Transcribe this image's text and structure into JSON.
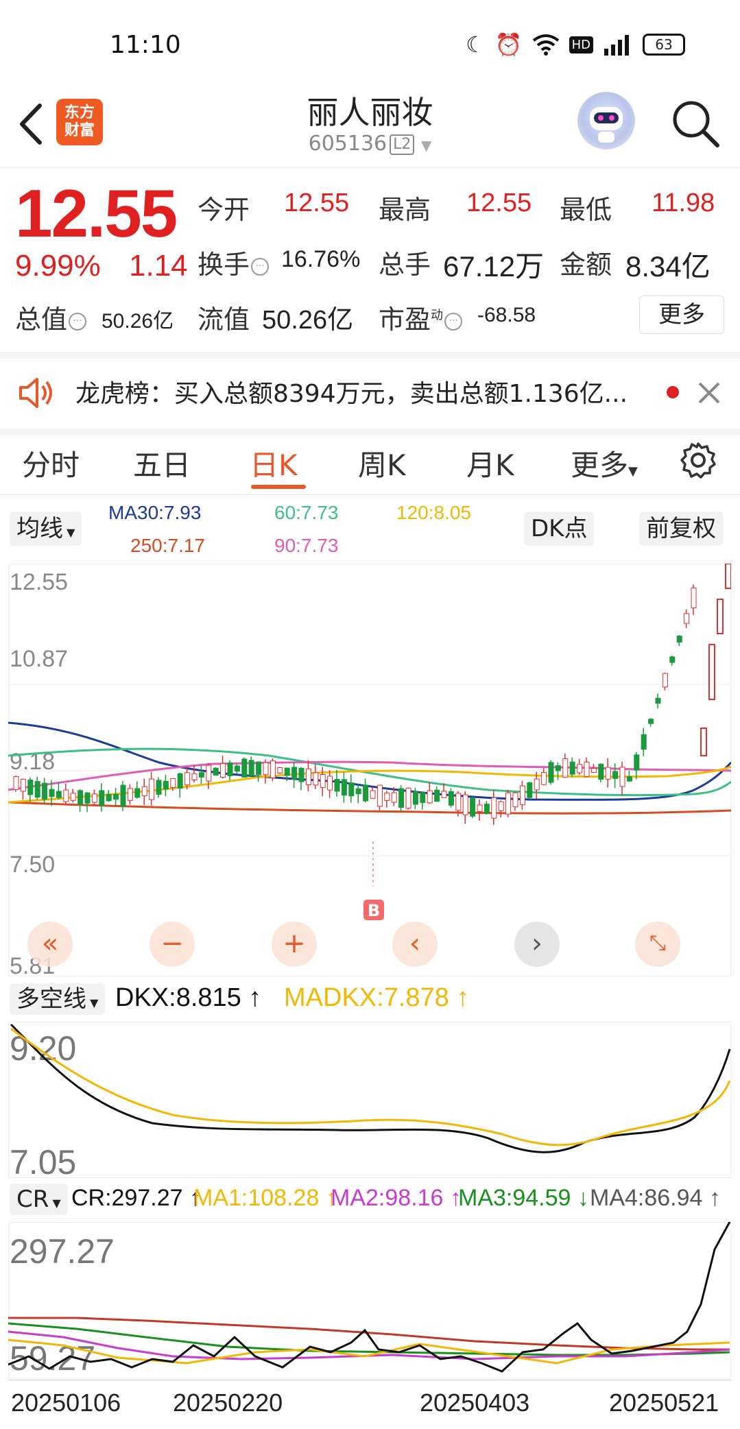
{
  "status": {
    "time": "11:10",
    "battery": "63"
  },
  "header": {
    "title": "丽人丽妆",
    "code": "605136",
    "level": "L2",
    "logo_line1": "东方",
    "logo_line2": "财富"
  },
  "quote": {
    "price": "12.55",
    "pct": "9.99%",
    "change": "1.14",
    "open_label": "今开",
    "open": "12.55",
    "high_label": "最高",
    "high": "12.55",
    "low_label": "最低",
    "low": "11.98",
    "turnover_label": "换手",
    "turnover": "16.76%",
    "volume_label": "总手",
    "volume": "67.12万",
    "amount_label": "金额",
    "amount": "8.34亿",
    "mktcap_label": "总值",
    "mktcap": "50.26亿",
    "float_label": "流值",
    "float": "50.26亿",
    "pe_label": "市盈",
    "pe_sup": "动",
    "pe": "-68.58",
    "more": "更多"
  },
  "notice": {
    "text": "龙虎榜：买入总额8394万元，卖出总额1.136亿..."
  },
  "tabs": [
    {
      "label": "分时"
    },
    {
      "label": "五日"
    },
    {
      "label": "日K"
    },
    {
      "label": "周K"
    },
    {
      "label": "月K"
    },
    {
      "label": "更多"
    }
  ],
  "ma": {
    "selector": "均线",
    "ma30": "MA30:7.93",
    "ma60": "60:7.73",
    "ma120": "120:8.05",
    "ma250": "250:7.17",
    "ma90": "90:7.73",
    "dk": "DK点",
    "adjust": "前复权",
    "colors": {
      "ma30": "#1a3a9c",
      "ma60": "#3cbf84",
      "ma120": "#f2b705",
      "ma250": "#d84a1f",
      "ma90": "#e05bb5"
    }
  },
  "kline": {
    "y_labels": [
      "12.55",
      "10.87",
      "9.18",
      "7.50",
      "5.81"
    ],
    "marker": "B"
  },
  "dkx": {
    "selector": "多空线",
    "dkx": "DKX:8.815",
    "madkx": "MADKX:7.878",
    "y_top": "9.20",
    "y_bottom": "7.05"
  },
  "cr": {
    "selector": "CR",
    "cr": "CR:297.27",
    "ma1": "MA1:108.28",
    "ma2": "MA2:98.16",
    "ma3": "MA3:94.59",
    "ma4": "MA4:86.94",
    "y_top": "297.27",
    "y_bottom": "59.27"
  },
  "dates": [
    "20250106",
    "20250220",
    "20250403",
    "20250521"
  ],
  "chart_data": {
    "type": "candlestick",
    "y_range": [
      5.81,
      12.55
    ],
    "last_close": 12.55,
    "recent_closes": [
      7.6,
      7.9,
      8.6,
      9.56,
      10.41,
      11.45,
      12.55
    ]
  }
}
